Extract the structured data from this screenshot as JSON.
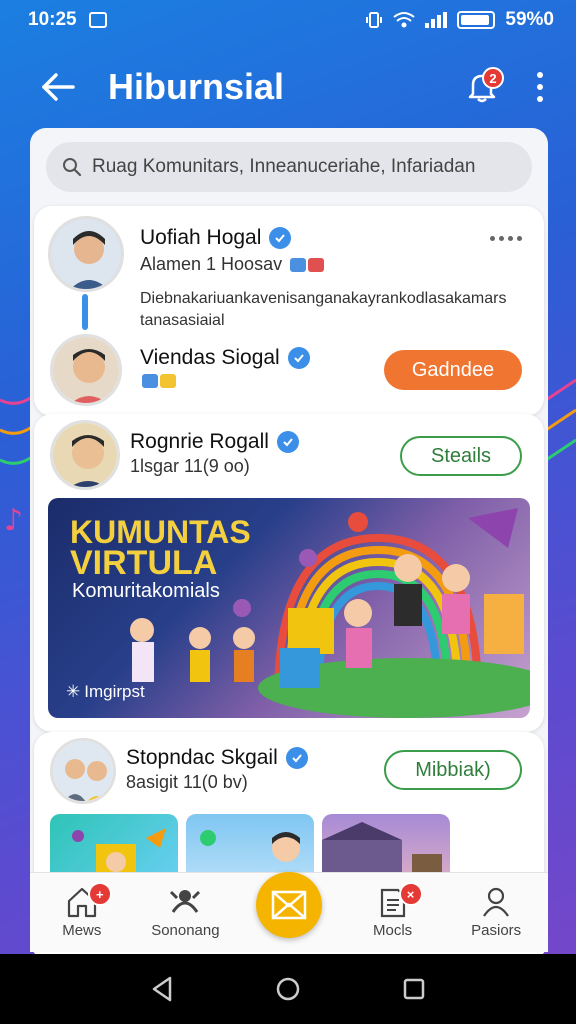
{
  "status_bar": {
    "time": "10:25",
    "battery": "59%0"
  },
  "app_bar": {
    "title": "Hiburnsial",
    "notification_count": "2"
  },
  "search": {
    "text": "Ruag Komunitars,   Inneanuceriahe,  Infariadan"
  },
  "posts": [
    {
      "name": "Uofiah Hogal",
      "subtitle": "Alamen 1 Hoosav",
      "description": "Diebnakariuankavenisanganakayrankodlasakamars tanasasiaial"
    },
    {
      "name": "Viendas Siogal",
      "button": "Gadndee"
    },
    {
      "name": "Rognrie Rogall",
      "subtitle": "1lsgar 11(9 oo)",
      "button": "Steails",
      "banner": {
        "title_line1": "KUMUNTAS",
        "title_line2": "VIRTULA",
        "subtitle": "Komuritakomials",
        "tag": "Imgirpst"
      }
    },
    {
      "name": "Stopndac Skgail",
      "subtitle": "8asigit 11(0 bv)",
      "button": "Mibbiak)"
    }
  ],
  "bottom_nav": [
    {
      "label": "Mews",
      "icon": "home-icon",
      "badge": "+"
    },
    {
      "label": "Sononang",
      "icon": "community-icon"
    },
    {
      "label": "",
      "icon": "mail-icon"
    },
    {
      "label": "Mocls",
      "icon": "document-icon",
      "badge": "×"
    },
    {
      "label": "Pasiors",
      "icon": "person-icon"
    }
  ],
  "colors": {
    "accent_orange": "#f07530",
    "accent_green": "#3a9d4a",
    "fab_yellow": "#f5b400",
    "verified_blue": "#3b8fe8",
    "badge_red": "#e53935"
  }
}
